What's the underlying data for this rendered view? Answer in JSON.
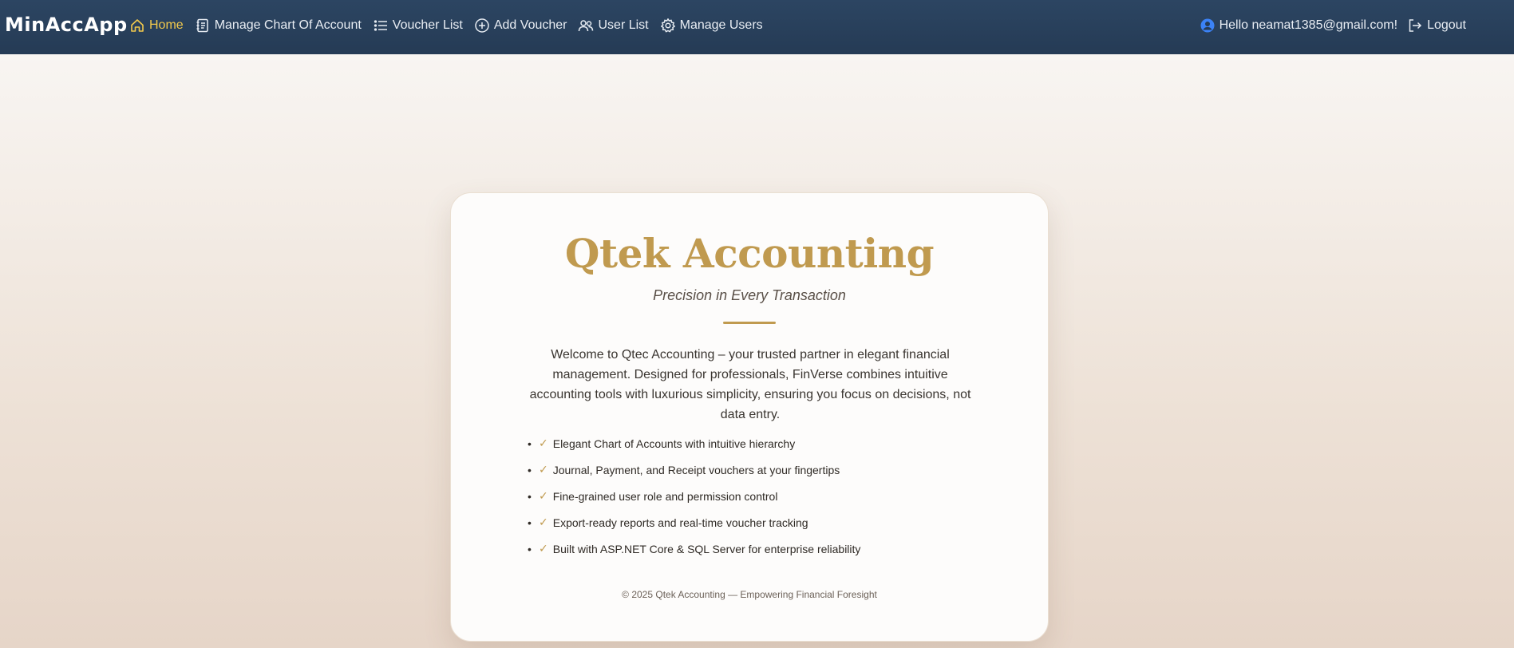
{
  "app": {
    "brand": "MinAccApp"
  },
  "nav": {
    "items": [
      {
        "label": "Home",
        "icon": "home-icon",
        "active": true
      },
      {
        "label": "Manage Chart Of Account",
        "icon": "journal-icon"
      },
      {
        "label": "Voucher List",
        "icon": "list-icon"
      },
      {
        "label": "Add Voucher",
        "icon": "plus-circle-icon"
      },
      {
        "label": "User List",
        "icon": "users-icon"
      },
      {
        "label": "Manage Users",
        "icon": "gear-icon"
      }
    ],
    "greeting": "Hello neamat1385@gmail.com!",
    "logout": "Logout"
  },
  "card": {
    "title": "Qtek Accounting",
    "subtitle": "Precision in Every Transaction",
    "intro": "Welcome to Qtec Accounting – your trusted partner in elegant financial management. Designed for professionals, FinVerse combines intuitive accounting tools with luxurious simplicity, ensuring you focus on decisions, not data entry.",
    "features": [
      "Elegant Chart of Accounts with intuitive hierarchy",
      "Journal, Payment, and Receipt vouchers at your fingertips",
      "Fine-grained user role and permission control",
      "Export-ready reports and real-time voucher tracking",
      "Built with ASP.NET Core & SQL Server for enterprise reliability"
    ],
    "check_mark": "✓",
    "footer": "© 2025 Qtek Accounting — Empowering Financial Foresight"
  },
  "colors": {
    "navbar": "#2c4562",
    "accent_gold": "#c09a4f",
    "active_nav": "#f2c94c",
    "user_icon": "#3b82f6"
  }
}
